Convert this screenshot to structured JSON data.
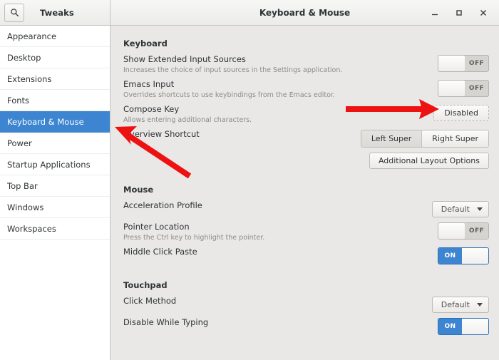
{
  "header": {
    "app_title": "Tweaks",
    "window_title": "Keyboard & Mouse",
    "search_icon": "search-icon",
    "minimize_label": "—",
    "maximize_label": "□",
    "close_label": "✕"
  },
  "sidebar": {
    "items": [
      {
        "label": "Appearance",
        "selected": false
      },
      {
        "label": "Desktop",
        "selected": false
      },
      {
        "label": "Extensions",
        "selected": false
      },
      {
        "label": "Fonts",
        "selected": false
      },
      {
        "label": "Keyboard & Mouse",
        "selected": true
      },
      {
        "label": "Power",
        "selected": false
      },
      {
        "label": "Startup Applications",
        "selected": false
      },
      {
        "label": "Top Bar",
        "selected": false
      },
      {
        "label": "Windows",
        "selected": false
      },
      {
        "label": "Workspaces",
        "selected": false
      }
    ]
  },
  "main": {
    "keyboard": {
      "title": "Keyboard",
      "show_extended_input_sources": {
        "label": "Show Extended Input Sources",
        "desc": "Increases the choice of input sources in the Settings application.",
        "toggle": "OFF"
      },
      "emacs_input": {
        "label": "Emacs Input",
        "desc": "Overrides shortcuts to use keybindings from the Emacs editor.",
        "toggle": "OFF"
      },
      "compose_key": {
        "label": "Compose Key",
        "desc": "Allows entering additional characters.",
        "button": "Disabled"
      },
      "overview_shortcut": {
        "label": "Overview Shortcut",
        "option_left": "Left Super",
        "option_right": "Right Super",
        "selected_option": "Left Super"
      },
      "additional_layout_options": "Additional Layout Options"
    },
    "mouse": {
      "title": "Mouse",
      "acceleration_profile": {
        "label": "Acceleration Profile",
        "value": "Default"
      },
      "pointer_location": {
        "label": "Pointer Location",
        "desc": "Press the Ctrl key to highlight the pointer.",
        "toggle": "OFF"
      },
      "middle_click_paste": {
        "label": "Middle Click Paste",
        "toggle": "ON"
      }
    },
    "touchpad": {
      "title": "Touchpad",
      "click_method": {
        "label": "Click Method",
        "value": "Default"
      },
      "disable_while_typing": {
        "label": "Disable While Typing",
        "toggle": "ON"
      }
    }
  },
  "annotations": {
    "arrow_color": "#ee1111",
    "arrow_to_compose_key": "horizontal arrow pointing right at the Disabled button",
    "arrow_to_overview_shortcut": "diagonal arrow pointing up-left at the Overview Shortcut row"
  },
  "colors": {
    "selection_blue": "#3d85d0",
    "panel_bg": "#e9e8e6",
    "sidebar_bg": "#ffffff",
    "text": "#2e3436",
    "muted_text": "#8b8b87"
  }
}
